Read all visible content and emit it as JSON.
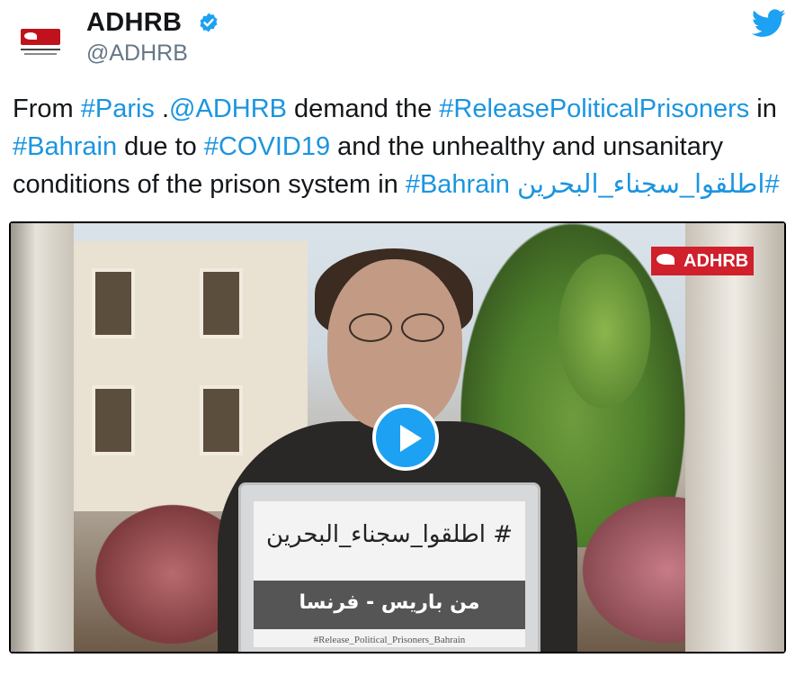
{
  "account": {
    "name": "ADHRB",
    "handle": "@ADHRB",
    "verified": true,
    "avatar_icon": "adhrb-logo-icon"
  },
  "platform_icon": "twitter-bird-icon",
  "tweet": {
    "segments": [
      {
        "text": "From ",
        "link": false
      },
      {
        "text": "#Paris",
        "link": true
      },
      {
        "text": " .",
        "link": false
      },
      {
        "text": "@ADHRB",
        "link": true
      },
      {
        "text": " demand the ",
        "link": false
      },
      {
        "text": "#ReleasePoliticalPrisoners",
        "link": true
      },
      {
        "text": " in ",
        "link": false
      },
      {
        "text": "#Bahrain",
        "link": true
      },
      {
        "text": " due to ",
        "link": false
      },
      {
        "text": "#COVID19",
        "link": true
      },
      {
        "text": " and the unhealthy and unsanitary conditions of the prison system in  ",
        "link": false
      },
      {
        "text": "#Bahrain",
        "link": true
      },
      {
        "text": " ",
        "link": false
      },
      {
        "text": "#اطلقوا_سجناء_البحرين",
        "link": true
      }
    ]
  },
  "video": {
    "watermark": "ADHRB",
    "laptop_hashtag_ar": "# اطلقوا_سجناء_البحرين",
    "laptop_city_ar": "من باريس - فرنسا",
    "laptop_hashtag_en": "#Release_Political_Prisoners_Bahrain",
    "play_icon": "play-icon"
  },
  "colors": {
    "link": "#1b95e0",
    "verified": "#1da1f2",
    "brand_red": "#d0202b"
  }
}
